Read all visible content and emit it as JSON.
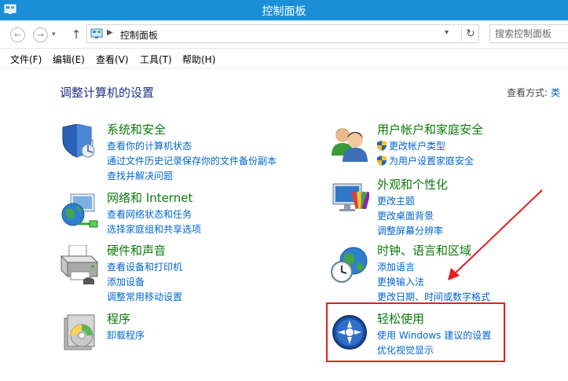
{
  "window": {
    "title": "控制面板"
  },
  "addressbar": {
    "path": "控制面板",
    "search_placeholder": "搜索控制面板"
  },
  "menubar": {
    "items": [
      "文件(F)",
      "编辑(E)",
      "查看(V)",
      "工具(T)",
      "帮助(H)"
    ]
  },
  "main": {
    "title": "调整计算机的设置",
    "view_by_label": "查看方式:",
    "view_by_value": "类"
  },
  "categories": [
    {
      "title": "系统和安全",
      "icon": "shield-computer-icon",
      "links": [
        "查看你的计算机状态",
        "通过文件历史记录保存你的文件备份副本",
        "查找并解决问题"
      ]
    },
    {
      "title": "网络和 Internet",
      "icon": "network-globe-icon",
      "links": [
        "查看网络状态和任务",
        "选择家庭组和共享选项"
      ]
    },
    {
      "title": "硬件和声音",
      "icon": "printer-icon",
      "links": [
        "查看设备和打印机",
        "添加设备",
        "调整常用移动设置"
      ]
    },
    {
      "title": "程序",
      "icon": "programs-disc-icon",
      "links": [
        "卸载程序"
      ]
    },
    {
      "title": "用户帐户和家庭安全",
      "icon": "users-icon",
      "links": [
        "更改帐户类型",
        "为用户设置家庭安全"
      ]
    },
    {
      "title": "外观和个性化",
      "icon": "monitor-palette-icon",
      "links": [
        "更改主题",
        "更改桌面背景",
        "调整屏幕分辨率"
      ]
    },
    {
      "title": "时钟、语言和区域",
      "icon": "clock-globe-icon",
      "links": [
        "添加语言",
        "更换输入法",
        "更改日期、时间或数字格式"
      ]
    },
    {
      "title": "轻松使用",
      "icon": "ease-of-access-icon",
      "links": [
        "使用 Windows 建议的设置",
        "优化视觉显示"
      ]
    }
  ],
  "annotation_color": "#e41e25",
  "accent_color": "#1a8fd8"
}
